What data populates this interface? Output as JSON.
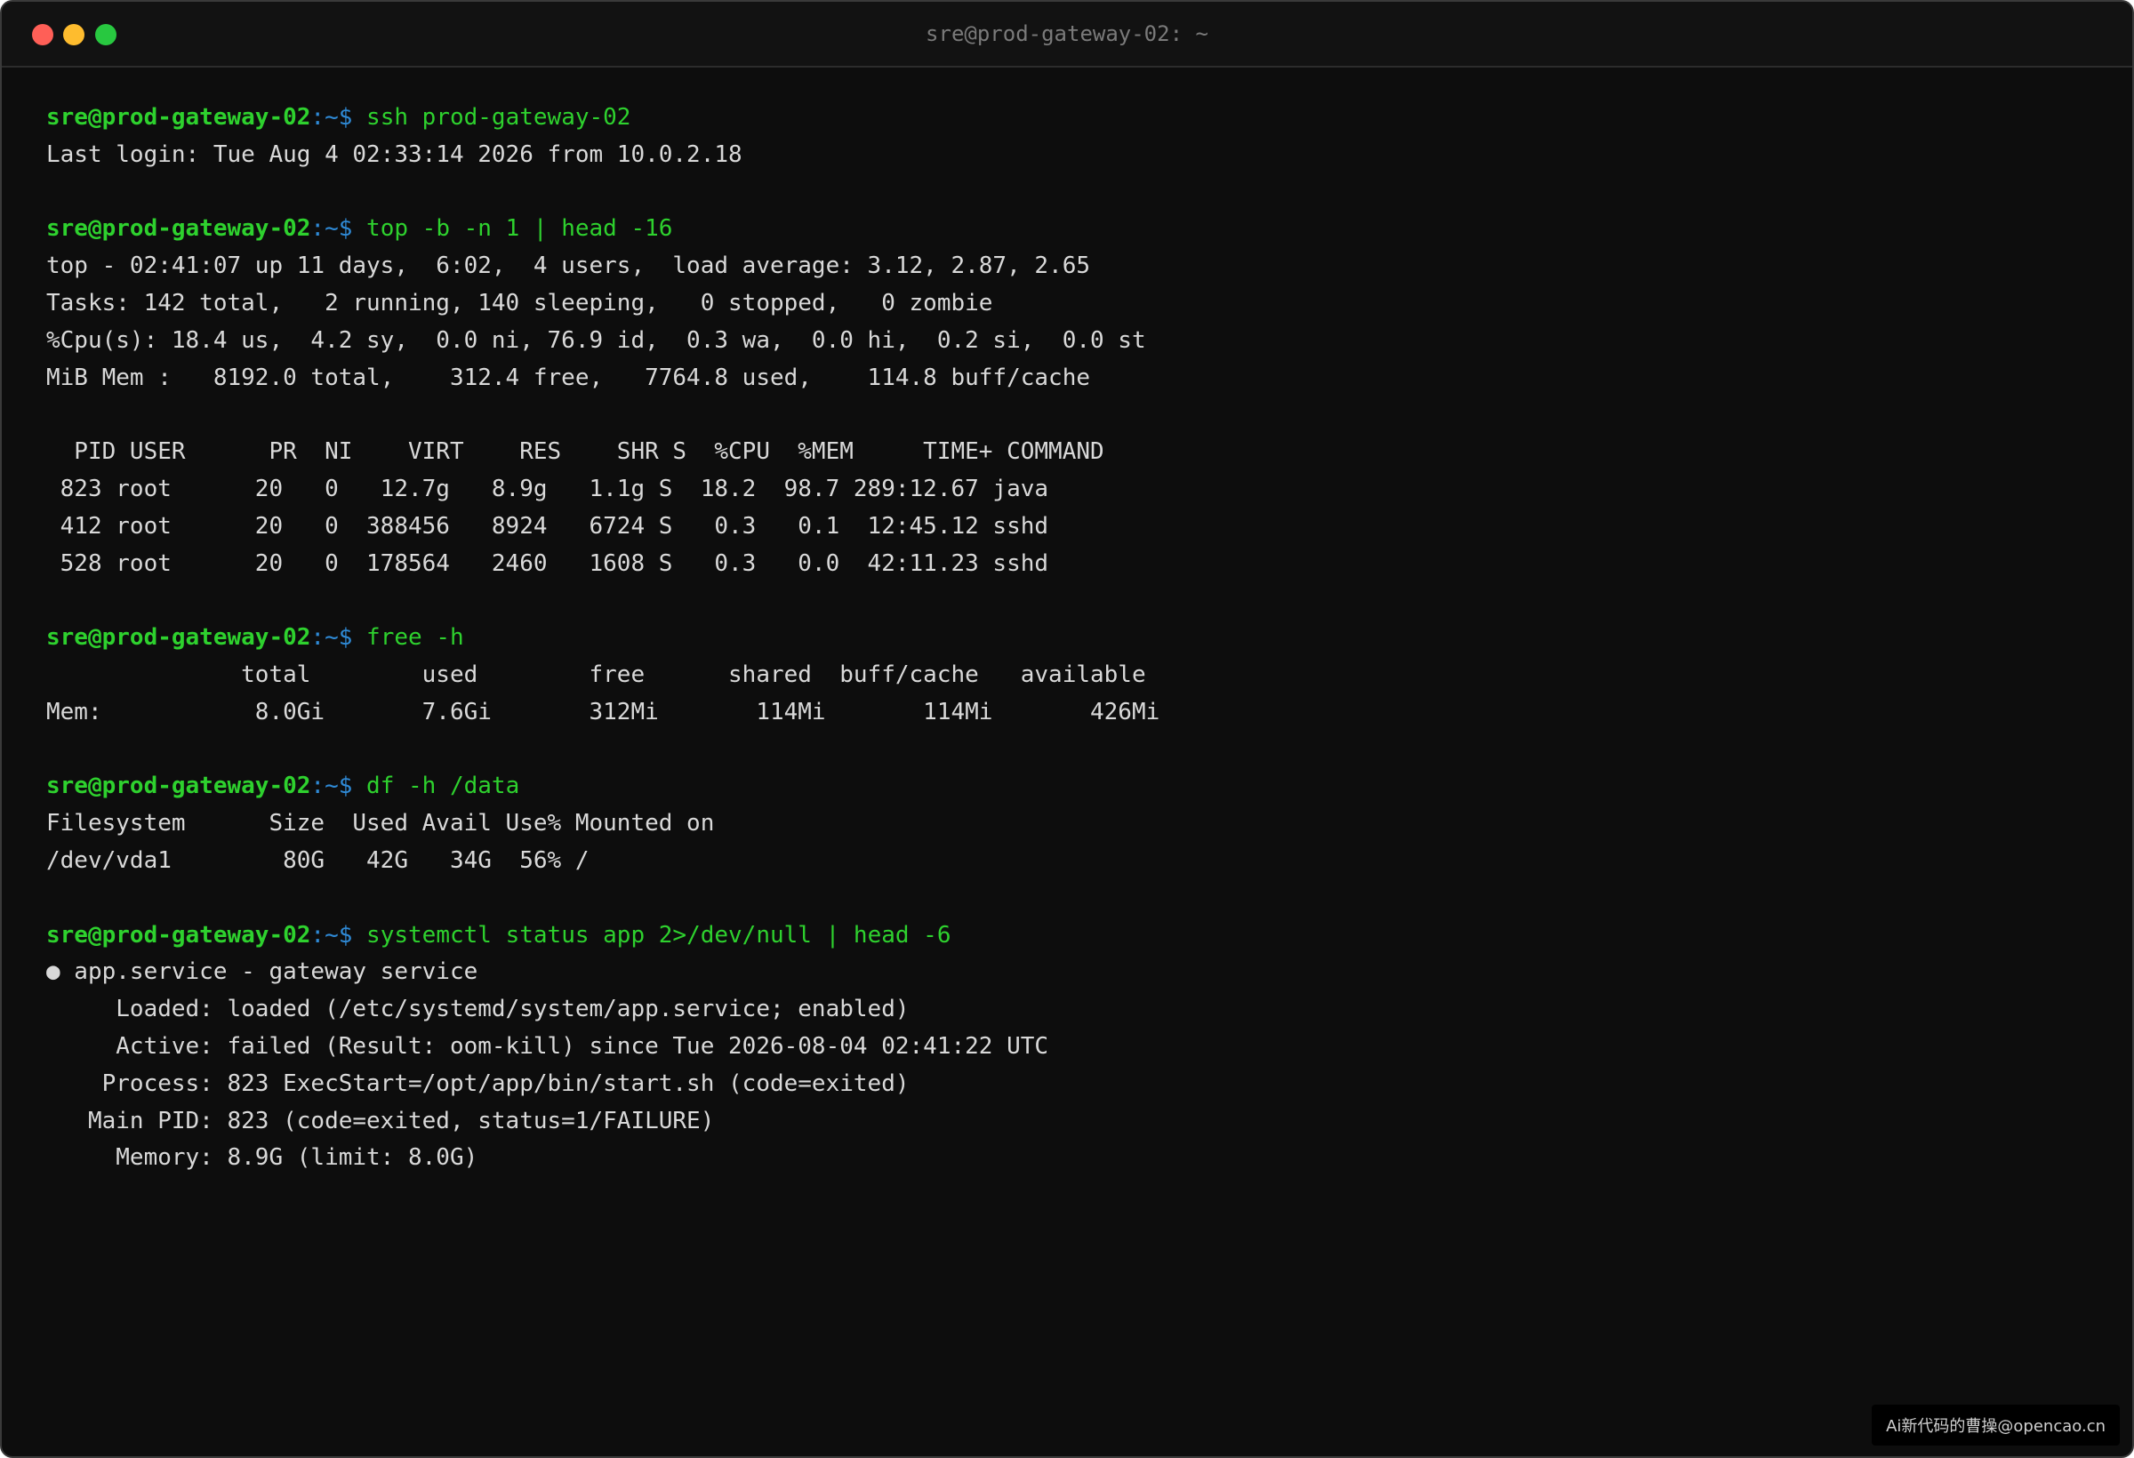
{
  "window": {
    "title": "sre@prod-gateway-02: ~"
  },
  "prompt": {
    "user_host": "sre@prod-gateway-02",
    "path_suffix": ":~$ "
  },
  "blocks": [
    {
      "command": "ssh prod-gateway-02",
      "output": [
        "Last login: Tue Aug 4 02:33:14 2026 from 10.0.2.18"
      ]
    },
    {
      "command": "top -b -n 1 | head -16",
      "output": [
        "top - 02:41:07 up 11 days,  6:02,  4 users,  load average: 3.12, 2.87, 2.65",
        "Tasks: 142 total,   2 running, 140 sleeping,   0 stopped,   0 zombie",
        "%Cpu(s): 18.4 us,  4.2 sy,  0.0 ni, 76.9 id,  0.3 wa,  0.0 hi,  0.2 si,  0.0 st",
        "MiB Mem :   8192.0 total,    312.4 free,   7764.8 used,    114.8 buff/cache",
        "",
        "  PID USER      PR  NI    VIRT    RES    SHR S  %CPU  %MEM     TIME+ COMMAND",
        " 823 root      20   0   12.7g   8.9g   1.1g S  18.2  98.7 289:12.67 java",
        " 412 root      20   0  388456   8924   6724 S   0.3   0.1  12:45.12 sshd",
        " 528 root      20   0  178564   2460   1608 S   0.3   0.0  42:11.23 sshd"
      ]
    },
    {
      "command": "free -h",
      "output": [
        "              total        used        free      shared  buff/cache   available",
        "Mem:           8.0Gi       7.6Gi       312Mi       114Mi       114Mi       426Mi"
      ]
    },
    {
      "command": "df -h /data",
      "output": [
        "Filesystem      Size  Used Avail Use% Mounted on",
        "/dev/vda1        80G   42G   34G  56% /"
      ]
    },
    {
      "command": "systemctl status app 2>/dev/null | head -6",
      "output": [
        "● app.service - gateway service",
        "     Loaded: loaded (/etc/systemd/system/app.service; enabled)",
        "     Active: failed (Result: oom-kill) since Tue 2026-08-04 02:41:22 UTC",
        "    Process: 823 ExecStart=/opt/app/bin/start.sh (code=exited)",
        "   Main PID: 823 (code=exited, status=1/FAILURE)",
        "     Memory: 8.9G (limit: 8.0G)"
      ]
    }
  ],
  "watermark": "Ai新代码的曹操@opencao.cn"
}
